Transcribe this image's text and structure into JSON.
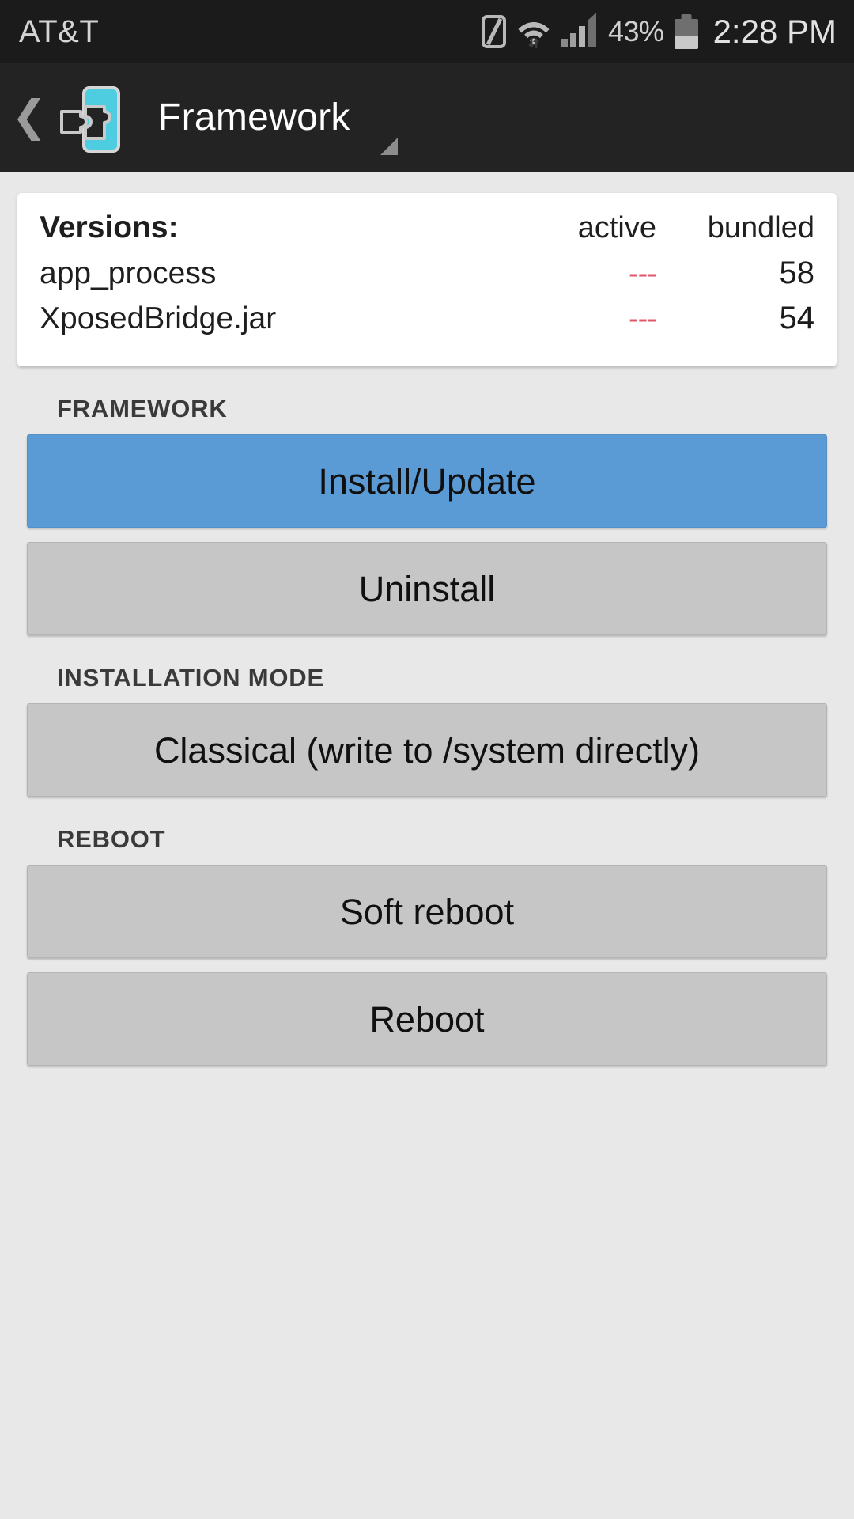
{
  "statusbar": {
    "carrier": "AT&T",
    "battery_percent": "43%",
    "battery_level": 43,
    "time": "2:28 PM",
    "icons": [
      "nfc-icon",
      "wifi-icon",
      "signal-icon",
      "battery-icon"
    ]
  },
  "actionbar": {
    "back_label": "❮",
    "app_icon": "xposed-logo-icon",
    "title": "Framework",
    "spinner_indicator": "dropdown-caret-icon",
    "accent_color": "#4ecde0"
  },
  "version_card": {
    "title": "Versions:",
    "columns": [
      "active",
      "bundled"
    ],
    "rows": [
      {
        "name": "app_process",
        "active": "---",
        "bundled": "58"
      },
      {
        "name": "XposedBridge.jar",
        "active": "---",
        "bundled": "54"
      }
    ],
    "inactive_color": "#e05668"
  },
  "sections": [
    {
      "label": "FRAMEWORK",
      "buttons": [
        {
          "label": "Install/Update",
          "style": "primary"
        },
        {
          "label": "Uninstall",
          "style": "default"
        }
      ]
    },
    {
      "label": "INSTALLATION MODE",
      "buttons": [
        {
          "label": "Classical (write to /system directly)",
          "style": "default"
        }
      ]
    },
    {
      "label": "REBOOT",
      "buttons": [
        {
          "label": "Soft reboot",
          "style": "default"
        },
        {
          "label": "Reboot",
          "style": "default"
        }
      ]
    }
  ],
  "colors": {
    "primary_button": "#5b9bd5",
    "default_button": "#c6c6c6",
    "page_background": "#e8e8e8",
    "bar_background": "#232323"
  }
}
